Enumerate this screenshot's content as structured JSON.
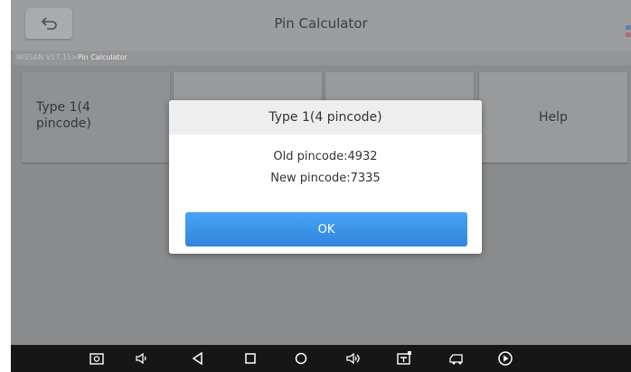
{
  "header": {
    "title": "Pin Calculator",
    "back_icon": "back-arrow-icon"
  },
  "breadcrumb": {
    "path": "NISSAN V17.15>",
    "current": "Pin Calculator"
  },
  "tiles": [
    {
      "label_line1": "Type 1(4",
      "label_line2": "pincode)"
    },
    {
      "label": ""
    },
    {
      "label": ""
    },
    {
      "label": "Help"
    }
  ],
  "dialog": {
    "title": "Type 1(4 pincode)",
    "old_pincode": "Old pincode:4932",
    "new_pincode": "New pincode:7335",
    "ok_label": "OK"
  },
  "navbar": {
    "icons": [
      "screenshot-icon",
      "volume-down-icon",
      "back-icon",
      "recents-icon",
      "home-icon",
      "volume-up-icon",
      "vci-icon",
      "car-icon",
      "play-icon"
    ]
  },
  "colors": {
    "ok_button": "#2f86dd",
    "navbar": "#161616"
  }
}
